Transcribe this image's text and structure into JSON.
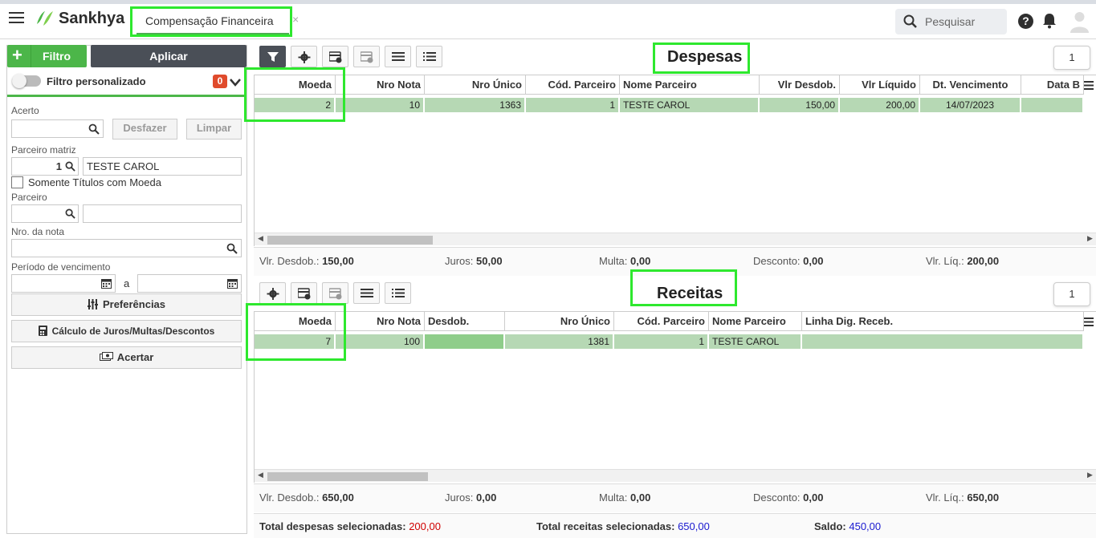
{
  "header": {
    "logo_text": "Sankhya",
    "tab_label": "Compensação Financeira",
    "tab_close": "×",
    "search_placeholder": "Pesquisar",
    "help_label": "?"
  },
  "left": {
    "filtro_label": "Filtro",
    "filtro_plus": "+",
    "aplicar_label": "Aplicar",
    "filtro_personalizado": "Filtro personalizado",
    "filtro_count": "0",
    "acerto_label": "Acerto",
    "desfazer_label": "Desfazer",
    "limpar_label": "Limpar",
    "parceiro_matriz_label": "Parceiro matriz",
    "parceiro_matriz_code": "1",
    "parceiro_matriz_name": "TESTE CAROL",
    "somente_label": "Somente Títulos com Moeda",
    "parceiro_label": "Parceiro",
    "nro_nota_label": "Nro. da nota",
    "periodo_label": "Período de vencimento",
    "periodo_sep": "a",
    "preferencias_label": "Preferências",
    "calculo_label": "Cálculo de Juros/Multas/Descontos",
    "acertar_label": "Acertar"
  },
  "despesas": {
    "title": "Despesas",
    "page": "1",
    "columns": [
      "Moeda",
      "Nro Nota",
      "Nro Único",
      "Cód. Parceiro",
      "Nome Parceiro",
      "Vlr Desdob.",
      "Vlr Líquido",
      "Dt. Vencimento",
      "Data B"
    ],
    "row": [
      "2",
      "10",
      "1363",
      "1",
      "TESTE CAROL",
      "150,00",
      "200,00",
      "14/07/2023",
      ""
    ],
    "totals": {
      "desdob_label": "Vlr. Desdob.:",
      "desdob_value": "150,00",
      "juros_label": "Juros:",
      "juros_value": "50,00",
      "multa_label": "Multa:",
      "multa_value": "0,00",
      "desconto_label": "Desconto:",
      "desconto_value": "0,00",
      "liq_label": "Vlr. Líq.:",
      "liq_value": "200,00"
    }
  },
  "receitas": {
    "title": "Receitas",
    "page": "1",
    "columns": [
      "Moeda",
      "Nro Nota",
      "Desdob.",
      "Nro Único",
      "Cód. Parceiro",
      "Nome Parceiro",
      "Linha Dig. Receb."
    ],
    "row": [
      "7",
      "100",
      "",
      "1381",
      "1",
      "TESTE CAROL",
      ""
    ],
    "totals": {
      "desdob_label": "Vlr. Desdob.:",
      "desdob_value": "650,00",
      "juros_label": "Juros:",
      "juros_value": "0,00",
      "multa_label": "Multa:",
      "multa_value": "0,00",
      "desconto_label": "Desconto:",
      "desconto_value": "0,00",
      "liq_label": "Vlr. Líq.:",
      "liq_value": "650,00"
    }
  },
  "footer": {
    "total_despesas_label": "Total despesas selecionadas:",
    "total_despesas_value": "200,00",
    "total_receitas_label": "Total receitas selecionadas:",
    "total_receitas_value": "650,00",
    "saldo_label": "Saldo:",
    "saldo_value": "450,00"
  },
  "colors": {
    "accent": "#4cb649",
    "row_selected": "#b6d8b4",
    "despesa_total": "#d00000",
    "receita_total": "#1a1ad0",
    "highlight": "#2ee82e"
  }
}
